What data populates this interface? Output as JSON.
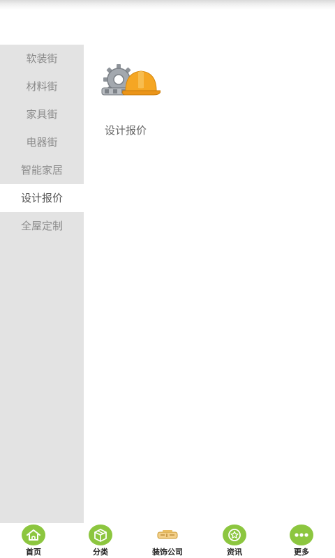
{
  "sidebar": {
    "items": [
      {
        "label": "软装街"
      },
      {
        "label": "材料街"
      },
      {
        "label": "家具街"
      },
      {
        "label": "电器街"
      },
      {
        "label": "智能家居"
      },
      {
        "label": "设计报价"
      },
      {
        "label": "全屋定制"
      }
    ],
    "active_index": 5
  },
  "content": {
    "tile": {
      "label": "设计报价",
      "icon": "gear-hardhat-icon"
    }
  },
  "bottom_nav": {
    "items": [
      {
        "label": "首页",
        "icon": "home-icon"
      },
      {
        "label": "分类",
        "icon": "box-icon"
      },
      {
        "label": "装饰公司",
        "icon": "company-logo-icon"
      },
      {
        "label": "资讯",
        "icon": "star-badge-icon"
      },
      {
        "label": "更多",
        "icon": "more-dots-icon"
      }
    ]
  },
  "colors": {
    "accent": "#8cc63f",
    "sidebar_bg": "#e3e3e3",
    "active_bg": "#ffffff"
  }
}
